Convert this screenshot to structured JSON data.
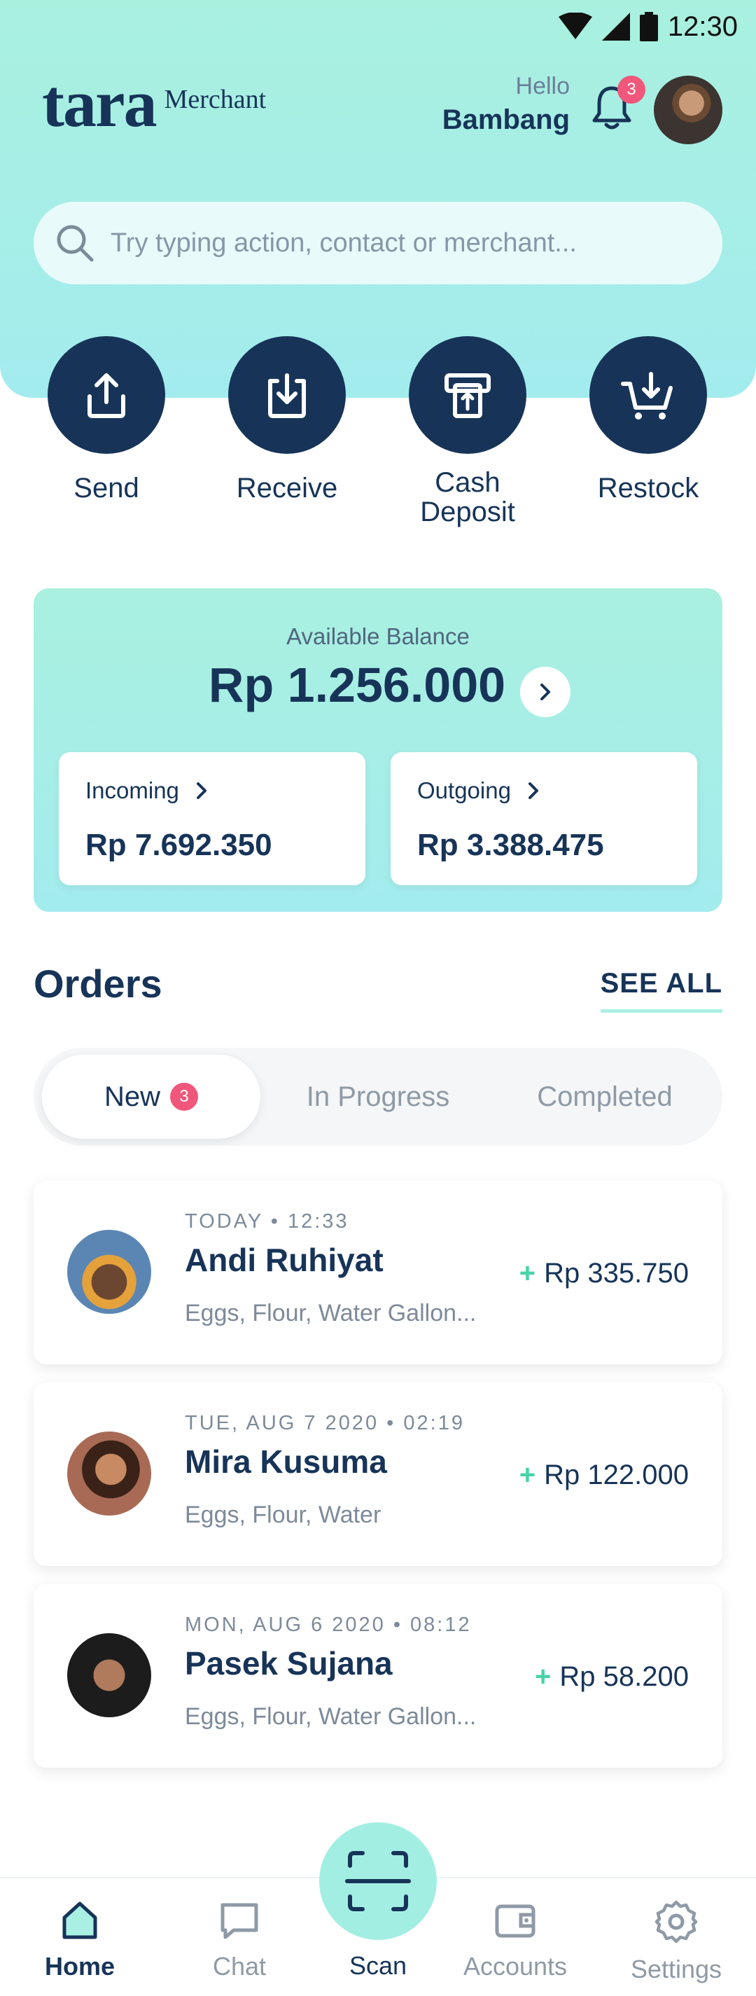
{
  "status": {
    "time": "12:30"
  },
  "brand": {
    "logo": "tara",
    "sub": "Merchant"
  },
  "user": {
    "hello": "Hello",
    "name": "Bambang",
    "notification_count": "3"
  },
  "search": {
    "placeholder": "Try typing action, contact or merchant..."
  },
  "actions": [
    {
      "label": "Send",
      "icon": "upload-icon"
    },
    {
      "label": "Receive",
      "icon": "download-icon"
    },
    {
      "label": "Cash Deposit",
      "icon": "cash-deposit-icon"
    },
    {
      "label": "Restock",
      "icon": "cart-icon"
    }
  ],
  "balance": {
    "caption": "Available Balance",
    "amount": "Rp 1.256.000",
    "incoming_label": "Incoming",
    "incoming_value": "Rp 7.692.350",
    "outgoing_label": "Outgoing",
    "outgoing_value": "Rp 3.388.475"
  },
  "orders": {
    "title": "Orders",
    "see_all": "SEE ALL",
    "tabs": [
      {
        "label": "New",
        "badge": "3"
      },
      {
        "label": "In Progress"
      },
      {
        "label": "Completed"
      }
    ],
    "list": [
      {
        "meta": "TODAY • 12:33",
        "name": "Andi Ruhiyat",
        "items": "Eggs, Flour, Water Gallon...",
        "amount": "Rp 335.750"
      },
      {
        "meta": "TUE, AUG 7 2020  • 02:19",
        "name": "Mira Kusuma",
        "items": "Eggs, Flour, Water",
        "amount": "Rp 122.000"
      },
      {
        "meta": "MON, AUG 6 2020  • 08:12",
        "name": "Pasek Sujana",
        "items": "Eggs, Flour, Water Gallon...",
        "amount": "Rp 58.200"
      }
    ]
  },
  "nav": {
    "home": "Home",
    "chat": "Chat",
    "scan": "Scan",
    "accounts": "Accounts",
    "settings": "Settings"
  },
  "colors": {
    "primary": "#173458",
    "accent": "#a9f0df",
    "badge": "#f0577b",
    "plus": "#46d3a8"
  }
}
